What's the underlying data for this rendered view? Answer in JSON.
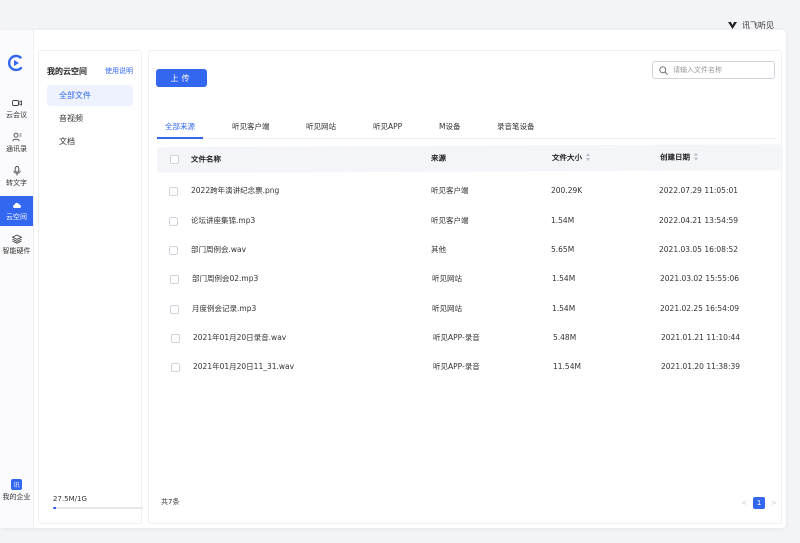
{
  "brand": {
    "name": "讯飞听见"
  },
  "nav": {
    "items": [
      {
        "key": "meeting",
        "label": "云会议",
        "icon": "video-camera-icon"
      },
      {
        "key": "contacts",
        "label": "通讯录",
        "icon": "contacts-icon"
      },
      {
        "key": "transcribe",
        "label": "转文字",
        "icon": "microphone-icon"
      },
      {
        "key": "cloud",
        "label": "云空间",
        "icon": "cloud-icon",
        "active": true
      },
      {
        "key": "hardware",
        "label": "智能硬件",
        "icon": "layers-icon"
      }
    ],
    "company": {
      "badge": "讯",
      "label": "我的企业"
    }
  },
  "sidebar": {
    "title": "我的云空间",
    "help": "使用说明",
    "items": [
      {
        "label": "全部文件",
        "active": true
      },
      {
        "label": "音视频"
      },
      {
        "label": "文档"
      }
    ],
    "storage": {
      "text": "27.5M/1G",
      "used_fraction": 0.03
    }
  },
  "main": {
    "upload_label": "上传",
    "search_placeholder": "请输入文件名称",
    "tabs": [
      "全部来源",
      "听见客户端",
      "听见网站",
      "听见APP",
      "M设备",
      "录音笔设备"
    ],
    "columns": {
      "name": "文件名称",
      "source": "来源",
      "size": "文件大小",
      "date": "创建日期"
    },
    "rows": [
      {
        "name": "2022跨年演讲纪念票.png",
        "source": "听见客户端",
        "size": "200.29K",
        "date": "2022.07.29 11:05:01"
      },
      {
        "name": "论坛讲座集锦.mp3",
        "source": "听见客户端",
        "size": "1.54M",
        "date": "2022.04.21 13:54:59"
      },
      {
        "name": "部门周例会.wav",
        "source": "其他",
        "size": "5.65M",
        "date": "2021.03.05 16:08:52"
      },
      {
        "name": "部门周例会02.mp3",
        "source": "听见网站",
        "size": "1.54M",
        "date": "2021.03.02 15:55:06"
      },
      {
        "name": "月度例会记录.mp3",
        "source": "听见网站",
        "size": "1.54M",
        "date": "2021.02.25 16:54:09"
      },
      {
        "name": "2021年01月20日录音.wav",
        "source": "听见APP-录音",
        "size": "5.48M",
        "date": "2021.01.21 11:10:44"
      },
      {
        "name": "2021年01月20日11_31.wav",
        "source": "听见APP-录音",
        "size": "11.54M",
        "date": "2021.01.20 11:38:39"
      }
    ],
    "total_label": "共7条",
    "pagination": {
      "current": "1",
      "prev": "<",
      "next": ">"
    }
  },
  "colors": {
    "accent": "#3367f0",
    "tab_active": "#3367f0"
  }
}
